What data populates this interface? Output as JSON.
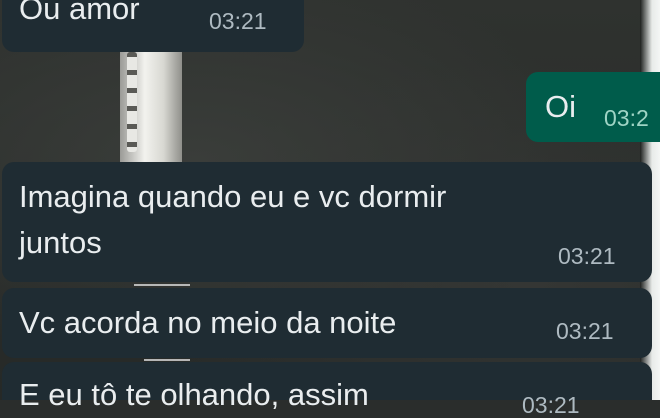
{
  "chat": {
    "messages": [
      {
        "direction": "incoming",
        "text": "Ou amor",
        "time": "03:21"
      },
      {
        "direction": "outgoing",
        "text": "Oi",
        "time": "03:2"
      },
      {
        "direction": "incoming",
        "text_line1": "Imagina quando eu e vc dormir",
        "text_line2": "juntos",
        "time": "03:21"
      },
      {
        "direction": "incoming",
        "text": "Vc acorda no meio da noite",
        "time": "03:21"
      },
      {
        "direction": "incoming",
        "text": "E eu tô te olhando, assim",
        "time": "03:21"
      }
    ]
  },
  "colors": {
    "incoming_bubble": "#1f2c33",
    "outgoing_bubble": "#005c4b",
    "message_text": "#e9edef",
    "timestamp": "#aebac1"
  }
}
